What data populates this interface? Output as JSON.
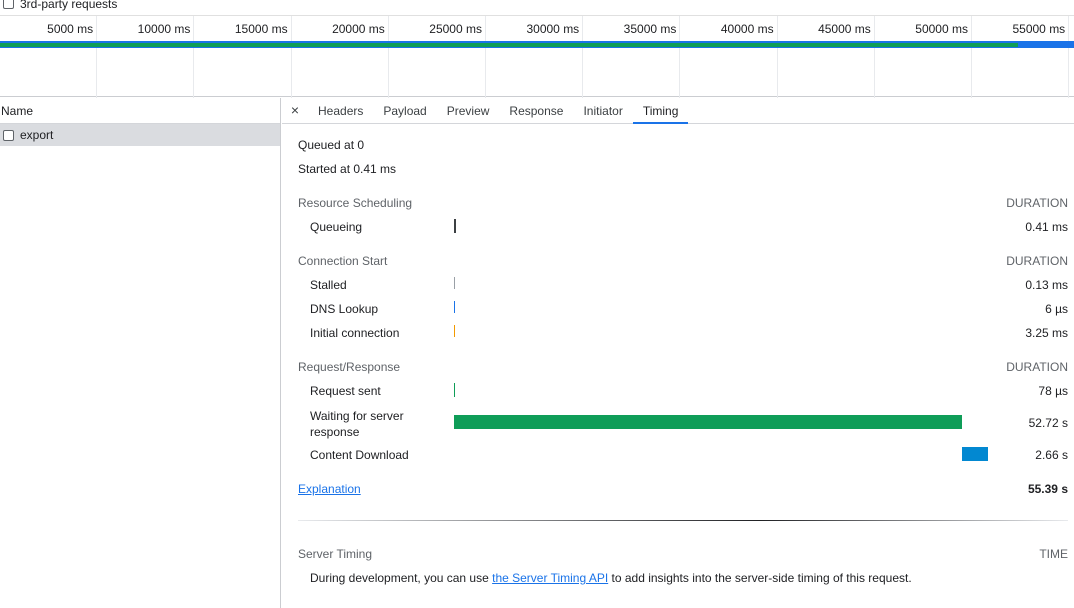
{
  "filter": {
    "third_party_label": "3rd-party requests"
  },
  "overview": {
    "ticks": [
      "5000 ms",
      "10000 ms",
      "15000 ms",
      "20000 ms",
      "25000 ms",
      "30000 ms",
      "35000 ms",
      "40000 ms",
      "45000 ms",
      "50000 ms",
      "55000 ms"
    ]
  },
  "name_panel": {
    "header": "Name",
    "requests": [
      {
        "name": "export"
      }
    ]
  },
  "tabs": {
    "close": "×",
    "items": [
      "Headers",
      "Payload",
      "Preview",
      "Response",
      "Initiator",
      "Timing"
    ],
    "active": "Timing"
  },
  "timing": {
    "queued": "Queued at 0",
    "started": "Started at 0.41 ms",
    "duration_label": "DURATION",
    "resource_scheduling": {
      "title": "Resource Scheduling",
      "rows": [
        {
          "label": "Queueing",
          "value": "0.41 ms"
        }
      ]
    },
    "connection_start": {
      "title": "Connection Start",
      "rows": [
        {
          "label": "Stalled",
          "value": "0.13 ms"
        },
        {
          "label": "DNS Lookup",
          "value": "6 µs"
        },
        {
          "label": "Initial connection",
          "value": "3.25 ms"
        }
      ]
    },
    "request_response": {
      "title": "Request/Response",
      "rows": [
        {
          "label": "Request sent",
          "value": "78 µs"
        },
        {
          "label": "Waiting for server response",
          "value": "52.72 s"
        },
        {
          "label": "Content Download",
          "value": "2.66 s"
        }
      ]
    },
    "explanation": "Explanation",
    "total": "55.39 s",
    "server_timing": {
      "title": "Server Timing",
      "time_label": "TIME",
      "desc_before": "During development, you can use ",
      "link": "the Server Timing API",
      "desc_after": " to add insights into the server-side timing of this request."
    }
  },
  "colors": {
    "accent": "#1a73e8",
    "waiting": "#0f9d58",
    "download": "#0288d1",
    "queueing": "#5f6368",
    "stalled": "#9aa0a6",
    "dns": "#1a73e8",
    "connection": "#f29900",
    "request_sent": "#0f9d58"
  }
}
